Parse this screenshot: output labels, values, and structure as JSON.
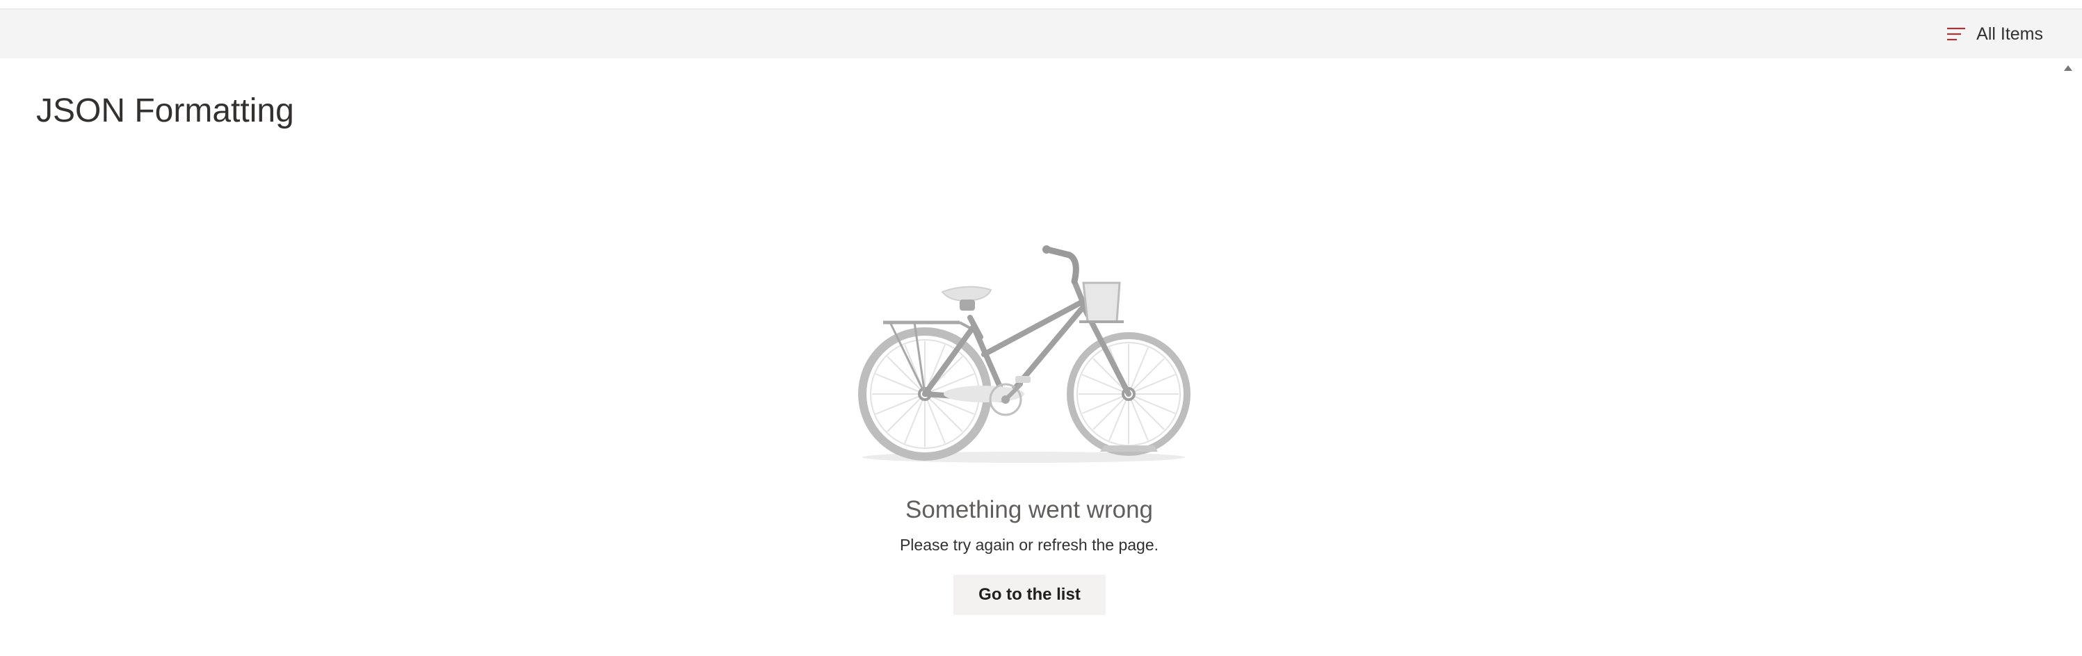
{
  "header": {
    "view_label": "All Items",
    "view_icon": "lines-icon",
    "accent_color": "#a4373a"
  },
  "page": {
    "title": "JSON Formatting"
  },
  "error": {
    "illustration": "bicycle-icon",
    "title": "Something went wrong",
    "message": "Please try again or refresh the page.",
    "button_label": "Go to the list"
  }
}
